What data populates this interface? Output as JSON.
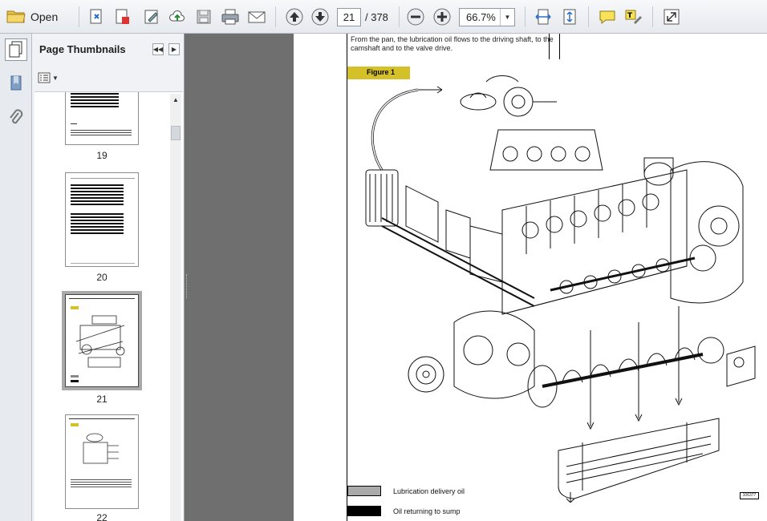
{
  "toolbar": {
    "open_label": "Open",
    "current_page": "21",
    "total_pages": "/ 378",
    "zoom": "66.7%"
  },
  "panel": {
    "title": "Page Thumbnails",
    "thumbnails": [
      {
        "label": "19",
        "selected": false
      },
      {
        "label": "20",
        "selected": false
      },
      {
        "label": "21",
        "selected": true
      },
      {
        "label": "22",
        "selected": false
      }
    ]
  },
  "document": {
    "intro_text": "From the pan, the lubrication oil flows to the driving shaft, to the camshaft and to the valve drive.",
    "figure_label": "Figure 1",
    "legend": [
      {
        "text": "Lubrication delivery oil",
        "color": "#aaaaaa"
      },
      {
        "text": "Oil returning to sump",
        "color": "#000000"
      }
    ],
    "figure_code": "106377"
  },
  "colors": {
    "figure_tag": "#d4c12a",
    "workspace": "#6f6f6f"
  }
}
